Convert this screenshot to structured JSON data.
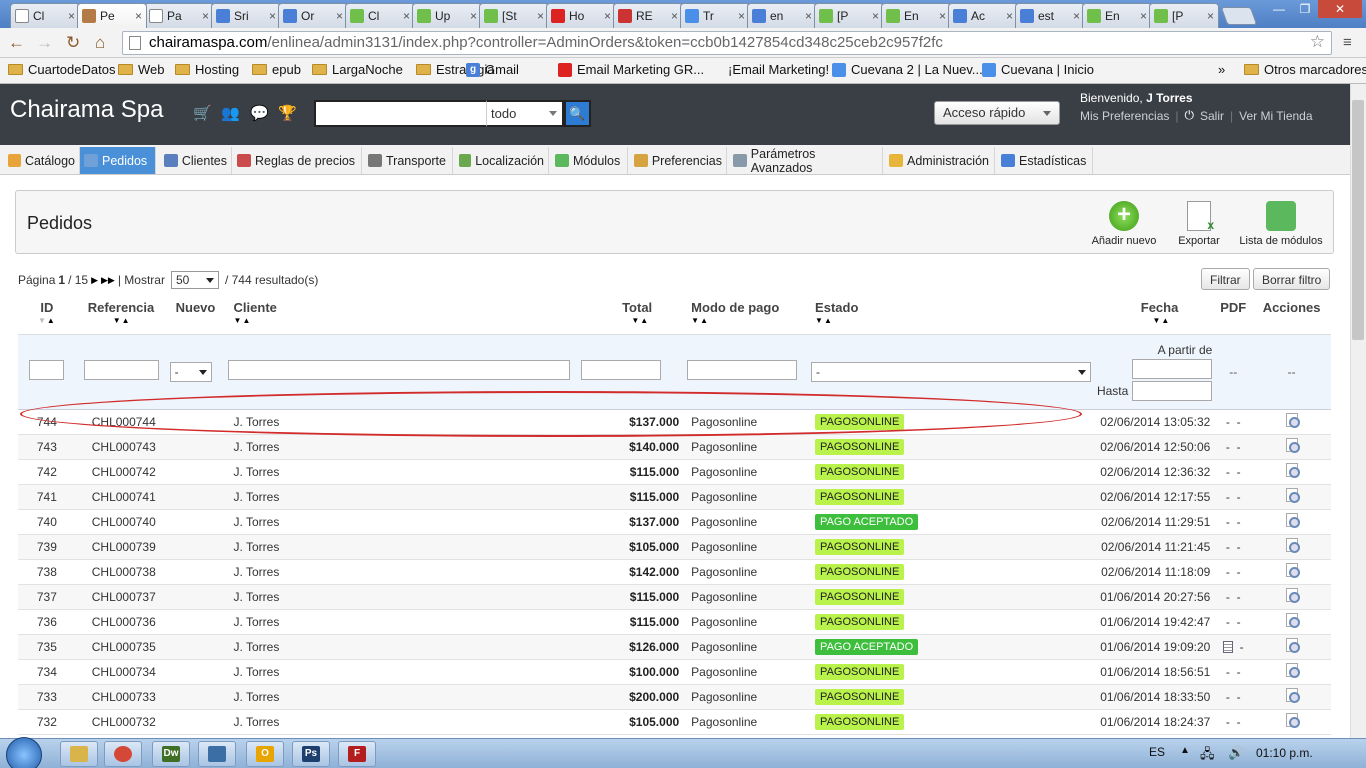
{
  "browser": {
    "tabs": [
      {
        "label": "Cl",
        "icon": "page-icon"
      },
      {
        "label": "Pe",
        "icon": "prestashop-icon"
      },
      {
        "label": "Pa",
        "icon": "page-icon"
      },
      {
        "label": "Sri",
        "icon": "google-icon"
      },
      {
        "label": "Or",
        "icon": "google-icon"
      },
      {
        "label": "Cl",
        "icon": "shop-icon"
      },
      {
        "label": "Up",
        "icon": "shop-icon"
      },
      {
        "label": "[St",
        "icon": "shop-icon"
      },
      {
        "label": "Ho",
        "icon": "red-icon"
      },
      {
        "label": "RE",
        "icon": "gmail-icon"
      },
      {
        "label": "Tr",
        "icon": "translate-icon"
      },
      {
        "label": "en",
        "icon": "google-icon"
      },
      {
        "label": "[P",
        "icon": "shop-icon"
      },
      {
        "label": "En",
        "icon": "shop-icon"
      },
      {
        "label": "Ac",
        "icon": "google-icon"
      },
      {
        "label": "est",
        "icon": "google-icon"
      },
      {
        "label": "En",
        "icon": "shop-icon"
      },
      {
        "label": "[P",
        "icon": "shop-icon"
      }
    ],
    "url_host": "chairamaspa.com",
    "url_path": "/enlinea/admin3131/index.php?controller=AdminOrders&token=ccb0b1427854cd348c25ceb2c957f2fc",
    "bookmarks": [
      {
        "label": "CuartodeDatos",
        "type": "folder"
      },
      {
        "label": "Web",
        "type": "folder"
      },
      {
        "label": "Hosting",
        "type": "folder"
      },
      {
        "label": "epub",
        "type": "folder"
      },
      {
        "label": "LargaNoche",
        "type": "folder"
      },
      {
        "label": "Estrategia",
        "type": "folder"
      },
      {
        "label": "Gmail",
        "type": "google"
      },
      {
        "label": "Email Marketing GR...",
        "type": "site"
      },
      {
        "label": "¡Email Marketing!",
        "type": "plain"
      },
      {
        "label": "Cuevana 2 | La Nuev...",
        "type": "site"
      },
      {
        "label": "Cuevana | Inicio",
        "type": "site"
      }
    ],
    "bookmarks_more": "»",
    "other_bookmarks": "Otros marcadores"
  },
  "header": {
    "brand": "Chairama Spa",
    "search_scope": "todo",
    "quick_access": "Acceso rápido",
    "welcome_prefix": "Bienvenido,",
    "welcome_user": "J Torres",
    "preferences_link": "Mis Preferencias",
    "logout_link": "Salir",
    "view_store_link": "Ver Mi Tienda"
  },
  "nav": [
    {
      "label": "Catálogo",
      "color": "#e8a33b"
    },
    {
      "label": "Pedidos",
      "color": "#6fa0d8"
    },
    {
      "label": "Clientes",
      "color": "#5a7fbf"
    },
    {
      "label": "Reglas de precios",
      "color": "#c94b4b"
    },
    {
      "label": "Transporte",
      "color": "#777777"
    },
    {
      "label": "Localización",
      "color": "#6aa84f"
    },
    {
      "label": "Módulos",
      "color": "#5cb85c"
    },
    {
      "label": "Preferencias",
      "color": "#d6a341"
    },
    {
      "label": "Parámetros Avanzados",
      "color": "#8899aa"
    },
    {
      "label": "Administración",
      "color": "#e8b53b"
    },
    {
      "label": "Estadísticas",
      "color": "#4a7fd8"
    }
  ],
  "page": {
    "title": "Pedidos",
    "actions": [
      {
        "label": "Añadir nuevo",
        "icon": "add-icon"
      },
      {
        "label": "Exportar",
        "icon": "export-icon"
      },
      {
        "label": "Lista de módulos",
        "icon": "modules-icon"
      }
    ]
  },
  "pager": {
    "page_label": "Página",
    "current_page": "1",
    "total_pages": "/ 15",
    "show_label": "| Mostrar",
    "per_page": "50",
    "results": "/ 744 resultado(s)"
  },
  "filter_button": "Filtrar",
  "reset_filter_button": "Borrar filtro",
  "table": {
    "columns": {
      "id": "ID",
      "reference": "Referencia",
      "new": "Nuevo",
      "customer": "Cliente",
      "total": "Total",
      "payment": "Modo de pago",
      "status": "Estado",
      "date": "Fecha",
      "pdf": "PDF",
      "actions": "Acciones"
    },
    "filters": {
      "new_value": "-",
      "status_value": "-",
      "date_from_label": "A partir de",
      "date_to_label": "Hasta",
      "pdf_placeholder": "--",
      "actions_placeholder": "--"
    },
    "rows": [
      {
        "id": "744",
        "ref": "CHL000744",
        "customer": "J. Torres",
        "total": "$137.000",
        "payment": "Pagosonline",
        "status": "PAGOSONLINE",
        "status_color": "#b9f24a",
        "date": "02/06/2014 13:05:32",
        "pdf": "-",
        "pdf2": "-",
        "invoice": false
      },
      {
        "id": "743",
        "ref": "CHL000743",
        "customer": "J. Torres",
        "total": "$140.000",
        "payment": "Pagosonline",
        "status": "PAGOSONLINE",
        "status_color": "#b9f24a",
        "date": "02/06/2014 12:50:06",
        "pdf": "-",
        "pdf2": "-",
        "invoice": false
      },
      {
        "id": "742",
        "ref": "CHL000742",
        "customer": "J. Torres",
        "total": "$115.000",
        "payment": "Pagosonline",
        "status": "PAGOSONLINE",
        "status_color": "#b9f24a",
        "date": "02/06/2014 12:36:32",
        "pdf": "-",
        "pdf2": "-",
        "invoice": false
      },
      {
        "id": "741",
        "ref": "CHL000741",
        "customer": "J. Torres",
        "total": "$115.000",
        "payment": "Pagosonline",
        "status": "PAGOSONLINE",
        "status_color": "#b9f24a",
        "date": "02/06/2014 12:17:55",
        "pdf": "-",
        "pdf2": "-",
        "invoice": false
      },
      {
        "id": "740",
        "ref": "CHL000740",
        "customer": "J. Torres",
        "total": "$137.000",
        "payment": "Pagosonline",
        "status": "PAGO ACEPTADO",
        "status_color": "#3dbf3d",
        "date": "02/06/2014 11:29:51",
        "pdf": "-",
        "pdf2": "-",
        "invoice": false
      },
      {
        "id": "739",
        "ref": "CHL000739",
        "customer": "J. Torres",
        "total": "$105.000",
        "payment": "Pagosonline",
        "status": "PAGOSONLINE",
        "status_color": "#b9f24a",
        "date": "02/06/2014 11:21:45",
        "pdf": "-",
        "pdf2": "-",
        "invoice": false
      },
      {
        "id": "738",
        "ref": "CHL000738",
        "customer": "J. Torres",
        "total": "$142.000",
        "payment": "Pagosonline",
        "status": "PAGOSONLINE",
        "status_color": "#b9f24a",
        "date": "02/06/2014 11:18:09",
        "pdf": "-",
        "pdf2": "-",
        "invoice": false
      },
      {
        "id": "737",
        "ref": "CHL000737",
        "customer": "J. Torres",
        "total": "$115.000",
        "payment": "Pagosonline",
        "status": "PAGOSONLINE",
        "status_color": "#b9f24a",
        "date": "01/06/2014 20:27:56",
        "pdf": "-",
        "pdf2": "-",
        "invoice": false
      },
      {
        "id": "736",
        "ref": "CHL000736",
        "customer": "J. Torres",
        "total": "$115.000",
        "payment": "Pagosonline",
        "status": "PAGOSONLINE",
        "status_color": "#b9f24a",
        "date": "01/06/2014 19:42:47",
        "pdf": "-",
        "pdf2": "-",
        "invoice": false
      },
      {
        "id": "735",
        "ref": "CHL000735",
        "customer": "J. Torres",
        "total": "$126.000",
        "payment": "Pagosonline",
        "status": "PAGO ACEPTADO",
        "status_color": "#3dbf3d",
        "date": "01/06/2014 19:09:20",
        "pdf": "",
        "pdf2": "-",
        "invoice": true
      },
      {
        "id": "734",
        "ref": "CHL000734",
        "customer": "J. Torres",
        "total": "$100.000",
        "payment": "Pagosonline",
        "status": "PAGOSONLINE",
        "status_color": "#b9f24a",
        "date": "01/06/2014 18:56:51",
        "pdf": "-",
        "pdf2": "-",
        "invoice": false
      },
      {
        "id": "733",
        "ref": "CHL000733",
        "customer": "J. Torres",
        "total": "$200.000",
        "payment": "Pagosonline",
        "status": "PAGOSONLINE",
        "status_color": "#b9f24a",
        "date": "01/06/2014 18:33:50",
        "pdf": "-",
        "pdf2": "-",
        "invoice": false
      },
      {
        "id": "732",
        "ref": "CHL000732",
        "customer": "J. Torres",
        "total": "$105.000",
        "payment": "Pagosonline",
        "status": "PAGOSONLINE",
        "status_color": "#b9f24a",
        "date": "01/06/2014 18:24:37",
        "pdf": "-",
        "pdf2": "-",
        "invoice": false
      }
    ]
  },
  "taskbar": {
    "apps": [
      {
        "name": "explorer",
        "color": "#d9b44a",
        "glyph": ""
      },
      {
        "name": "chrome",
        "color": "#d34836",
        "glyph": ""
      },
      {
        "name": "dreamweaver",
        "color": "#3f6f24",
        "glyph": "Dw"
      },
      {
        "name": "putty",
        "color": "#3a6ea5",
        "glyph": ""
      },
      {
        "name": "outlook",
        "color": "#e8a400",
        "glyph": "O"
      },
      {
        "name": "photoshop",
        "color": "#1c3f6e",
        "glyph": "Ps"
      },
      {
        "name": "filezilla",
        "color": "#b31d1d",
        "glyph": "F"
      }
    ],
    "lang": "ES",
    "clock": "01:10 p.m."
  }
}
